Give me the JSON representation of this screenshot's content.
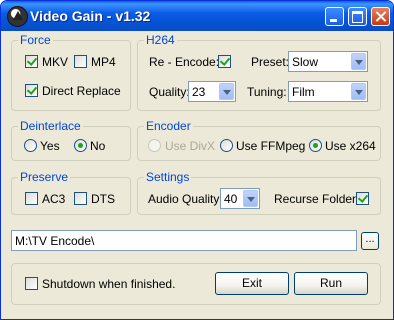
{
  "window": {
    "title": "Video Gain - v1.32"
  },
  "force": {
    "legend": "Force",
    "mkv": {
      "label": "MKV",
      "checked": true
    },
    "mp4": {
      "label": "MP4",
      "checked": false
    },
    "direct_replace": {
      "label": "Direct Replace",
      "checked": true
    }
  },
  "h264": {
    "legend": "H264",
    "reencode": {
      "label": "Re - Encode:",
      "checked": true
    },
    "preset": {
      "label": "Preset:",
      "value": "Slow"
    },
    "quality": {
      "label": "Quality:",
      "value": "23"
    },
    "tuning": {
      "label": "Tuning:",
      "value": "Film"
    }
  },
  "deinterlace": {
    "legend": "Deinterlace",
    "yes": {
      "label": "Yes",
      "selected": false
    },
    "no": {
      "label": "No",
      "selected": true
    }
  },
  "encoder": {
    "legend": "Encoder",
    "divx": {
      "label": "Use DivX",
      "selected": false,
      "disabled": true
    },
    "ffmpeg": {
      "label": "Use FFMpeg",
      "selected": false
    },
    "x264": {
      "label": "Use x264",
      "selected": true
    }
  },
  "preserve": {
    "legend": "Preserve",
    "ac3": {
      "label": "AC3",
      "checked": false
    },
    "dts": {
      "label": "DTS",
      "checked": false
    }
  },
  "settings": {
    "legend": "Settings",
    "audio_quality": {
      "label": "Audio Quality:",
      "value": "40"
    },
    "recurse": {
      "label": "Recurse Folders:",
      "checked": true
    }
  },
  "path": {
    "value": "M:\\TV Encode\\",
    "browse_label": "..."
  },
  "footer": {
    "shutdown": {
      "label": "Shutdown when finished.",
      "checked": false
    },
    "exit_label": "Exit",
    "run_label": "Run"
  }
}
